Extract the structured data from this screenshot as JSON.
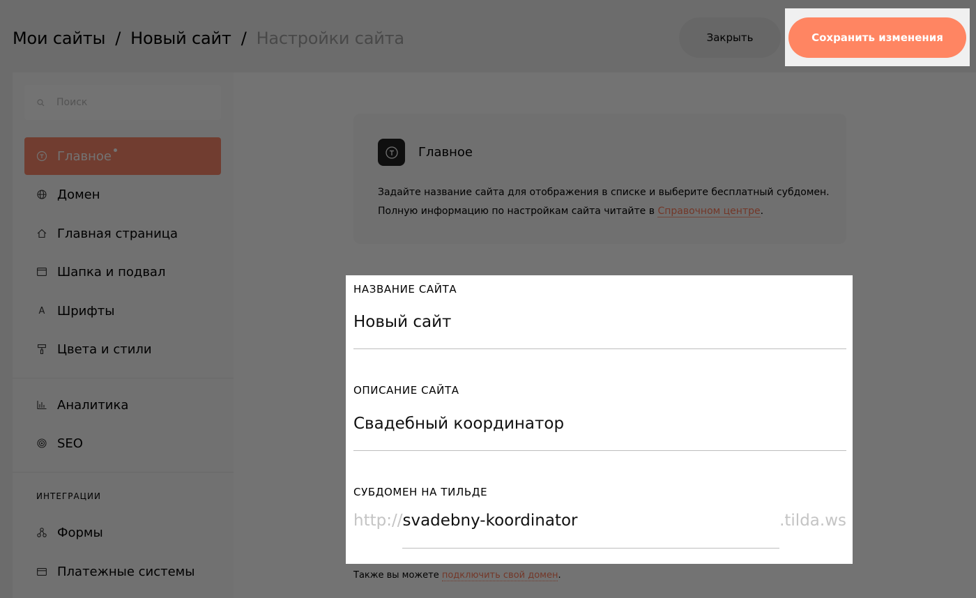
{
  "header": {
    "breadcrumb": [
      "Мои сайты",
      "Новый сайт",
      "Настройки сайта"
    ],
    "separator": "/",
    "close_label": "Закрыть",
    "save_label": "Сохранить изменения"
  },
  "sidebar": {
    "search_placeholder": "Поиск",
    "items": [
      {
        "label": "Главное",
        "icon": "tilda-logo-icon",
        "active": true
      },
      {
        "label": "Домен",
        "icon": "globe-icon"
      },
      {
        "label": "Главная страница",
        "icon": "home-icon"
      },
      {
        "label": "Шапка и подвал",
        "icon": "layout-icon"
      },
      {
        "label": "Шрифты",
        "icon": "font-icon"
      },
      {
        "label": "Цвета и стили",
        "icon": "paint-roller-icon"
      },
      {
        "label": "Аналитика",
        "icon": "chart-icon"
      },
      {
        "label": "SEO",
        "icon": "target-icon"
      },
      {
        "label": "Формы",
        "icon": "nodes-icon"
      },
      {
        "label": "Платежные системы",
        "icon": "card-icon"
      }
    ],
    "section_integrations": "ИНТЕГРАЦИИ"
  },
  "info_card": {
    "title": "Главное",
    "text": "Задайте название сайта для отображения в списке и выберите бесплатный субдомен. Полную информацию по настройкам сайта читайте в ",
    "link": "Справочном центре",
    "tail": "."
  },
  "form": {
    "site_name_label": "НАЗВАНИЕ САЙТА",
    "site_name_value": "Новый сайт",
    "description_label": "ОПИСАНИЕ САЙТА",
    "description_value": "Свадебный координатор",
    "subdomain_label": "СУБДОМЕН НА ТИЛЬДЕ",
    "subdomain_prefix": "http://",
    "subdomain_value": "svadebny-koordinator",
    "subdomain_suffix": ".tilda.ws",
    "footnote_text": "Также вы можете ",
    "footnote_link": "подключить свой домен",
    "footnote_tail": "."
  },
  "colors": {
    "accent": "#ff8562",
    "active_nav": "#fa876b"
  }
}
